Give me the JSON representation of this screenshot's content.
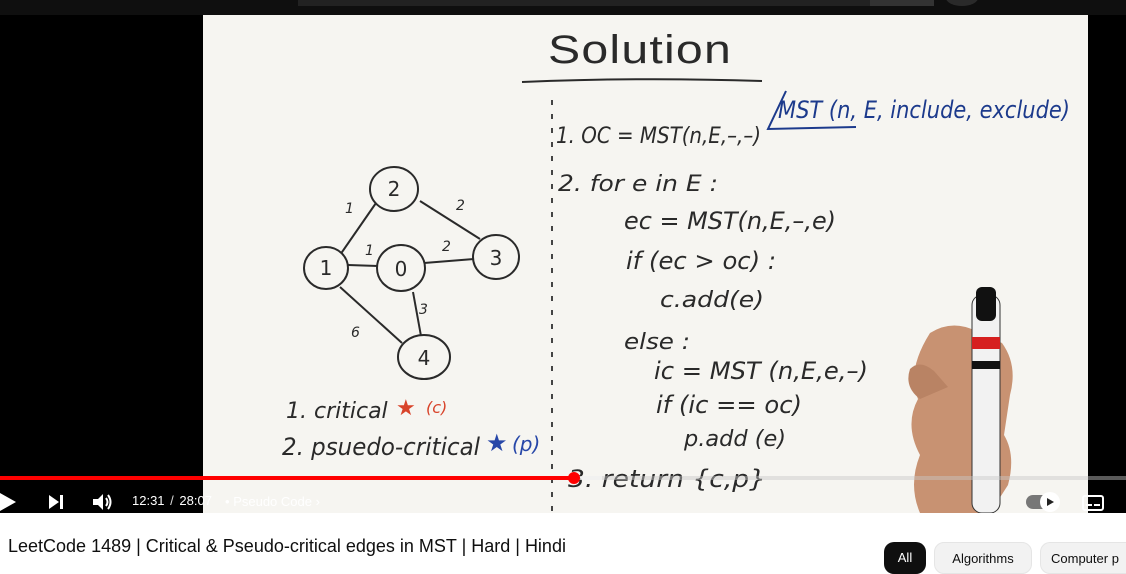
{
  "video": {
    "chapter_title": "Pseudo Code",
    "current_time": "12:31",
    "duration": "28:07",
    "separator": "/",
    "bullet": "•",
    "progress_fraction": 0.51,
    "buffered_fraction": 0.535
  },
  "whiteboard": {
    "heading": "Solution",
    "step1": "1. OC = MST(n,E,–,–)",
    "signature": "MST (n, E, include, exclude)",
    "step2": "2. for e in E :",
    "line_ec": "ec = MST(n,E,–,e)",
    "line_if1": "if (ec > oc) :",
    "line_cadd": "c.add(e)",
    "line_else": "else :",
    "line_ic": "ic = MST (n,E,e,–)",
    "line_if2": "if (ic == oc)",
    "line_padd": "p.add (e)",
    "step3": "3. return {c,p}",
    "legend_critical": "1. critical",
    "legend_critical_tag": "(c)",
    "legend_pseudo": "2. psuedo-critical",
    "legend_pseudo_tag": "(p)",
    "graph": {
      "nodes": [
        "0",
        "1",
        "2",
        "3",
        "4"
      ],
      "edge_weights": {
        "1-2": "1",
        "2-3": "2",
        "1-0": "1",
        "0-3": "2",
        "0-4": "3",
        "1-4": "6"
      }
    }
  },
  "video_title": "LeetCode 1489 | Critical & Pseudo-critical edges in MST | Hard | Hindi",
  "chips": [
    "All",
    "Algorithms",
    "Computer p"
  ],
  "colors": {
    "progress": "#ff0000",
    "critical_star": "#d8432a",
    "pseudo_star": "#2747a8",
    "signature_ink": "#1c3a8c"
  }
}
